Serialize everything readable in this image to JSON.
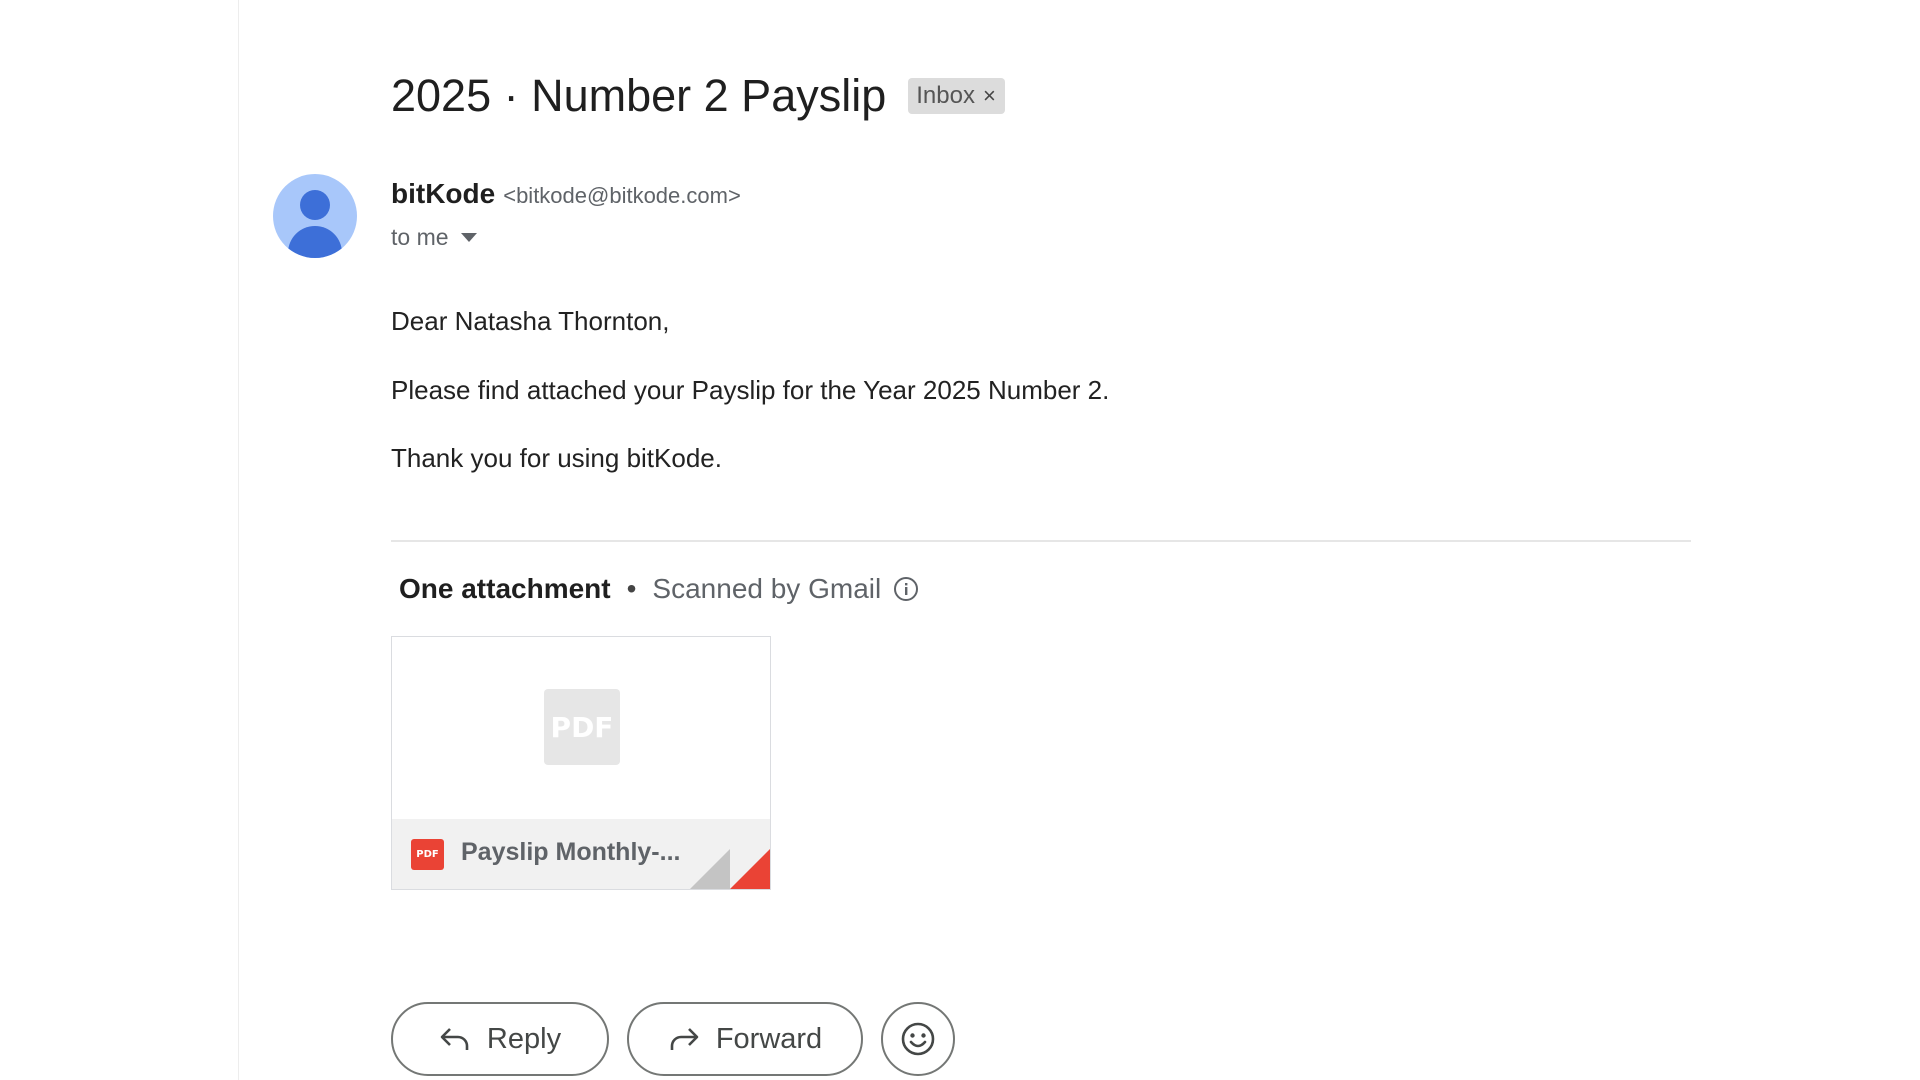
{
  "message": {
    "subject": "2025 · Number 2 Payslip",
    "label": "Inbox",
    "label_remove": "×"
  },
  "sender": {
    "name": "bitKode",
    "email": "<bitkode@bitkode.com>",
    "recipient": "to me"
  },
  "body": {
    "greeting": "Dear Natasha Thornton,",
    "line1": "Please find attached your Payslip for the Year 2025 Number 2.",
    "line2": "Thank you for using bitKode."
  },
  "attachments": {
    "heading": "One attachment",
    "separator": "•",
    "scanned": "Scanned by Gmail",
    "file": {
      "preview_label": "PDF",
      "type_badge": "PDF",
      "name": "Payslip Monthly-..."
    }
  },
  "actions": {
    "reply": "Reply",
    "forward": "Forward"
  },
  "colors": {
    "avatar_bg": "#a8c7fa",
    "avatar_fg": "#3d6fd8",
    "pdf_red": "#ea4335"
  }
}
